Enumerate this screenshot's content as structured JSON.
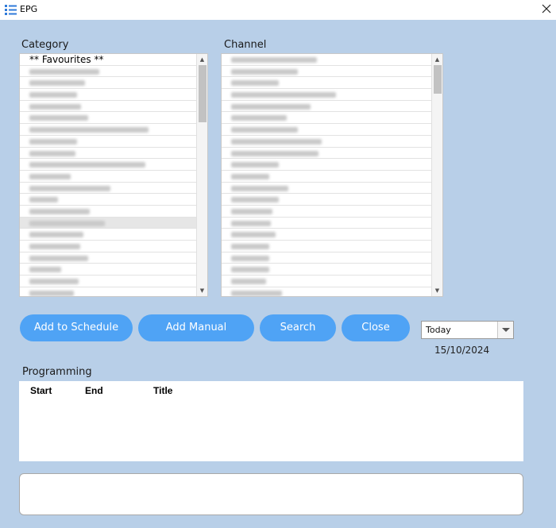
{
  "window": {
    "title": "EPG",
    "close_icon": "close-icon",
    "app_icon": "list-icon"
  },
  "category": {
    "label": "Category",
    "first_item": "** Favourites **",
    "blurred_widths": [
      88,
      70,
      60,
      65,
      74,
      150,
      60,
      58,
      146,
      52,
      102,
      36,
      76,
      95,
      68,
      64,
      74,
      40,
      62,
      56,
      82
    ]
  },
  "channel": {
    "label": "Channel",
    "blurred_widths": [
      108,
      84,
      60,
      132,
      100,
      70,
      84,
      114,
      110,
      60,
      48,
      72,
      60,
      52,
      50,
      56,
      48,
      48,
      48,
      44,
      64
    ]
  },
  "buttons": {
    "add_schedule": "Add to Schedule",
    "add_manual": "Add Manual",
    "search": "Search",
    "close": "Close"
  },
  "day_select": {
    "value": "Today"
  },
  "date": "15/10/2024",
  "programming": {
    "label": "Programming",
    "columns": [
      "Start",
      "End",
      "Title"
    ]
  },
  "colors": {
    "background": "#b8cfe8",
    "button": "#4fa3f5"
  }
}
